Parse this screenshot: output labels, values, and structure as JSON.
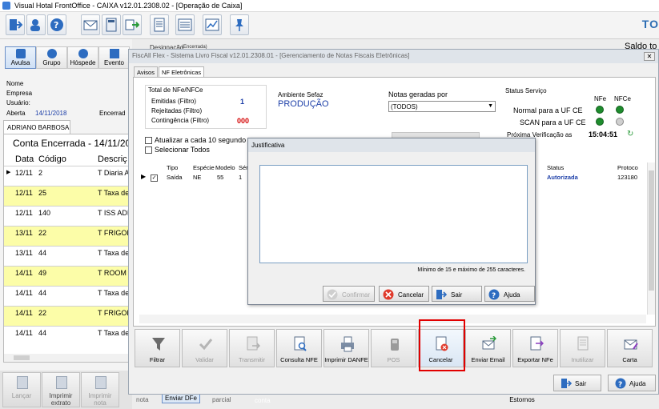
{
  "window": {
    "title": "Visual Hotal FrontOffice - CAIXA v12.01.2308.02 - [Operação de Caixa]"
  },
  "toolbar": {
    "right_text": "TO",
    "behind_text": "Designação",
    "behind_badge": "(Encerrada)",
    "saldo_text": "Saldo to"
  },
  "left_panel": {
    "buttons": [
      "Avulsa",
      "Grupo",
      "Hóspede",
      "Evento"
    ],
    "fields": {
      "nome": "Nome",
      "empresa": "Empresa",
      "usuario": "Usuário:",
      "aberta": "Aberta",
      "aberta_date": "14/11/2018",
      "encerrada": "Encerrad"
    },
    "tab": "ADRIANO BARBOSA",
    "conta_title": "Conta Encerrada - 14/11/201",
    "columns": [
      "Data",
      "Código",
      "Descriç"
    ],
    "rows": [
      {
        "data": "12/11",
        "codigo": "2",
        "descricao": "T Diaria A",
        "yellow": false
      },
      {
        "data": "12/11",
        "codigo": "25",
        "descricao": "T Taxa de",
        "yellow": true
      },
      {
        "data": "12/11",
        "codigo": "140",
        "descricao": "T ISS ADI",
        "yellow": false
      },
      {
        "data": "13/11",
        "codigo": "22",
        "descricao": "T FRIGOB",
        "yellow": true
      },
      {
        "data": "13/11",
        "codigo": "44",
        "descricao": "T Taxa de",
        "yellow": false
      },
      {
        "data": "14/11",
        "codigo": "49",
        "descricao": "T ROOM",
        "yellow": true
      },
      {
        "data": "14/11",
        "codigo": "44",
        "descricao": "T Taxa de",
        "yellow": false
      },
      {
        "data": "14/11",
        "codigo": "22",
        "descricao": "T FRIGOB",
        "yellow": true
      },
      {
        "data": "14/11",
        "codigo": "44",
        "descricao": "T Taxa de",
        "yellow": false
      }
    ],
    "bottom_buttons": [
      {
        "label": "Lançar",
        "disabled": true
      },
      {
        "label": "Imprimir extrato",
        "disabled": false
      },
      {
        "label": "Imprimir nota",
        "disabled": true
      }
    ],
    "behind_bottom": [
      "nota",
      "Enviar DFe",
      "parcial",
      "conta"
    ]
  },
  "fiscal": {
    "title": "FiscAll Flex - Sistema Livro Fiscal v12.01.2308.01 - [Gerenciamento de Notas Fiscais Eletrônicas]",
    "close": "✕",
    "tabs": [
      "Avisos",
      "NF Eletrônicas"
    ],
    "totals": {
      "title": "Total de NFe/NFCe",
      "emitidas": "Emitidas (Filtro)",
      "emitidas_value": "1",
      "rejeitadas": "Rejeitadas (Filtro)",
      "contingencia": "Contingência (Filtro)",
      "contingencia_value": "000"
    },
    "ambiente": {
      "label": "Ambiente Sefaz",
      "value": "PRODUÇÃO"
    },
    "notas": {
      "label": "Notas geradas por",
      "value": "(TODOS)"
    },
    "status": {
      "title": "Status Serviço",
      "col_nfe": "NFe",
      "col_nfce": "NFCe",
      "normal": "Normal para a UF CE",
      "scan": "SCAN para a UF CE",
      "proxima": "Próxima Verificação as",
      "time": "15:04:51"
    },
    "checks": {
      "atualizar": "Atualizar a cada 10 segundo",
      "selecionar": "Selecionar Todos"
    },
    "grid": {
      "headers": [
        "Tipo",
        "Espécie",
        "Modelo",
        "Séri"
      ],
      "right_headers": [
        "Status",
        "Protoco"
      ],
      "row": {
        "tipo": "Saída",
        "especie": "NE",
        "modelo": "55",
        "serie": "1",
        "status": "Autorizada",
        "protocolo": "123180"
      }
    },
    "buttons": [
      {
        "label": "Filtrar",
        "icon": "filter-icon",
        "disabled": false
      },
      {
        "label": "Validar",
        "icon": "check-icon",
        "disabled": true
      },
      {
        "label": "Transmitir",
        "icon": "transmit-icon",
        "disabled": true
      },
      {
        "label": "Consulta NFE",
        "icon": "document-search-icon",
        "disabled": false
      },
      {
        "label": "Imprimir DANFE",
        "icon": "printer-icon",
        "disabled": false
      },
      {
        "label": "POS",
        "icon": "pos-icon",
        "disabled": true
      },
      {
        "label": "Cancelar",
        "icon": "document-cancel-icon",
        "disabled": false
      },
      {
        "label": "Enviar Email",
        "icon": "email-icon",
        "disabled": false
      },
      {
        "label": "Exportar NFe",
        "icon": "export-icon",
        "disabled": false
      },
      {
        "label": "Inutilizar",
        "icon": "document-void-icon",
        "disabled": true
      },
      {
        "label": "Carta",
        "icon": "letter-icon",
        "disabled": false
      }
    ],
    "sair": "Sair",
    "ajuda": "Ajuda"
  },
  "status_bar": {
    "estornos": "Estornos"
  },
  "justificativa": {
    "title": "Justificativa",
    "text": "",
    "hint": "Mínimo de 15 e máximo de 255 caracteres.",
    "confirmar": "Confirmar",
    "cancelar": "Cancelar",
    "sair": "Sair",
    "ajuda": "Ajuda"
  },
  "colors": {
    "accent_blue": "#2c6db3",
    "status_green": "#1e8c2d",
    "row_yellow": "#fcfda8",
    "highlight_red": "#e20000",
    "value_red": "#d40000"
  }
}
